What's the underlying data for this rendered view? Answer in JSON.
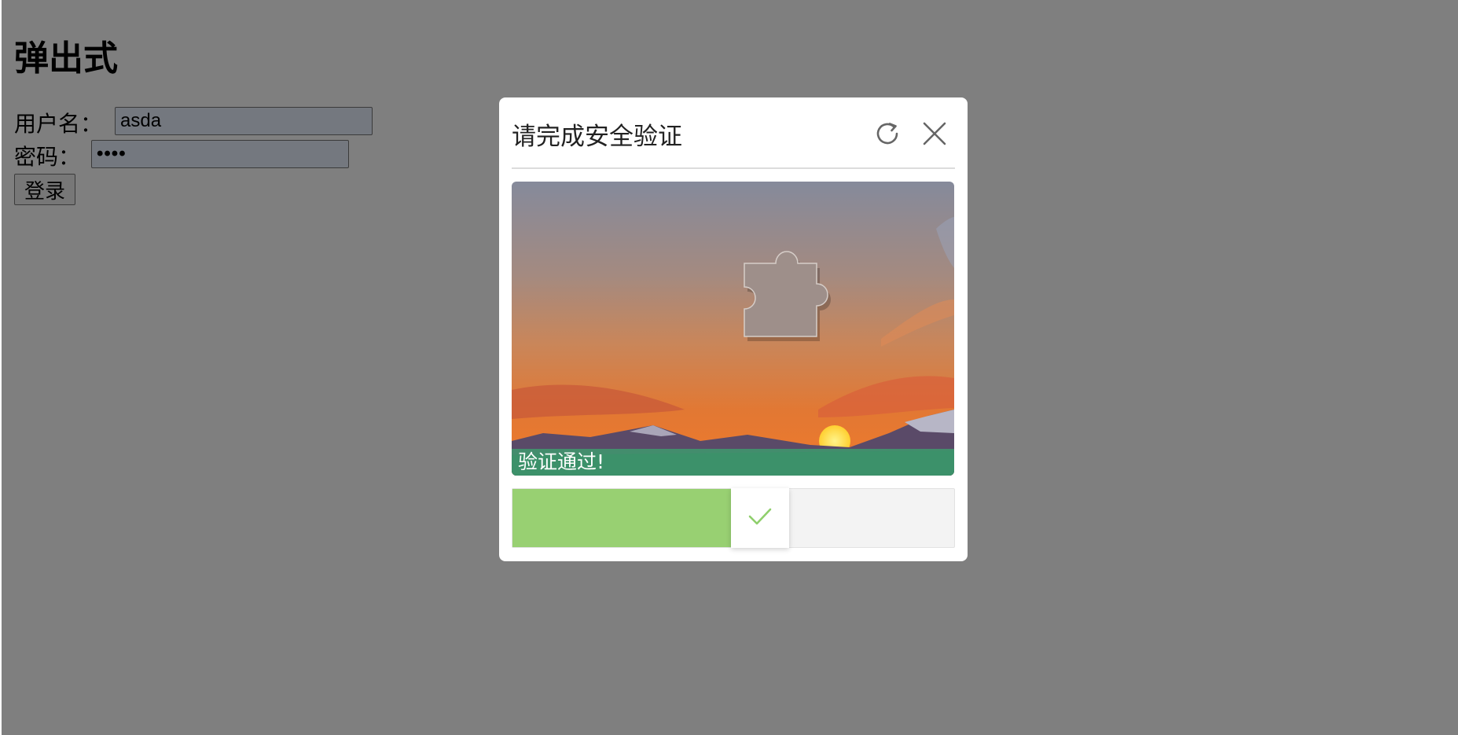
{
  "page": {
    "heading": "弹出式",
    "username_label": "用户名：",
    "username_value": "asda",
    "password_label": "密码：",
    "password_value": "••••",
    "login_button": "登录"
  },
  "captcha": {
    "title": "请完成安全验证",
    "refresh_icon": "refresh-icon",
    "close_icon": "close-icon",
    "status_text": "验证通过!",
    "slider_progress": 0.57,
    "handle_icon": "check-icon",
    "colors": {
      "success_fill": "#98d072",
      "status_bar": "#3ca06e",
      "check": "#8fcf6c"
    }
  }
}
